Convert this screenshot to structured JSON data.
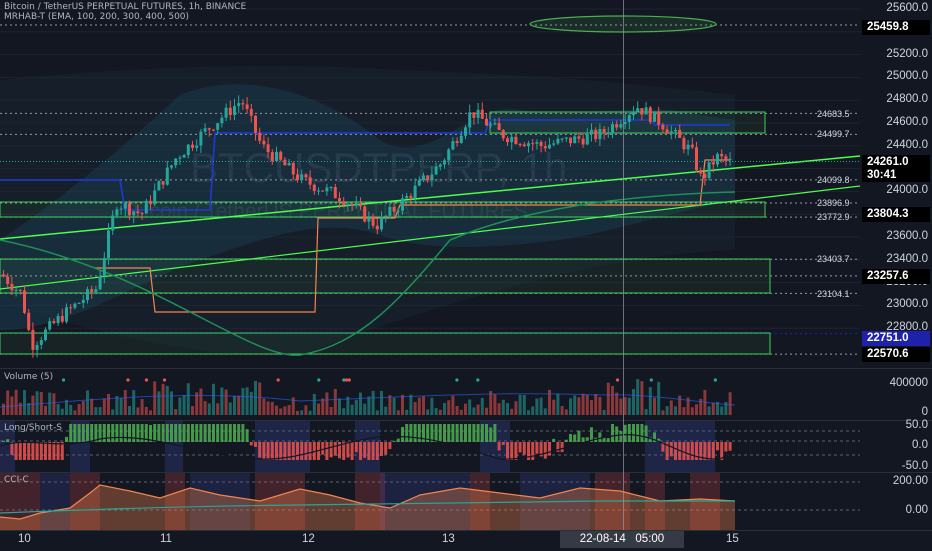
{
  "header": {
    "line1": "Bitcoin / TetherUS PERPETUAL FUTURES, 1h, BINANCE",
    "line2": "MRHAB-T (EMA, 100, 200, 300, 400, 500)"
  },
  "watermark": {
    "symbol": "BTCUSDTPERP, 1h",
    "name": "Bitcoin / TetherUS PERPETUAL FUTURES"
  },
  "price_axis": {
    "ticks": [
      "25600.0",
      "25400.0",
      "25200.0",
      "25000.0",
      "24800.0",
      "24600.0",
      "24400.0",
      "24200.0",
      "24000.0",
      "23800.0",
      "23600.0",
      "23400.0",
      "23200.0",
      "23000.0",
      "22800.0"
    ]
  },
  "price_boxes": {
    "top": "25459.8",
    "current": "24261.0",
    "countdown": "30:41",
    "level": "23804.3",
    "level2": "23257.6",
    "blue": "22751.0",
    "bottom": "22570.6"
  },
  "levels": {
    "l1": "24683.5",
    "l2": "24499.7",
    "l3": "24099.8",
    "l4": "23896.9",
    "l5": "23772.9",
    "l6": "23403.7",
    "l7": "23104.1"
  },
  "volume": {
    "title": "Volume (5)",
    "ticks": [
      "400000",
      "0"
    ]
  },
  "longshort": {
    "title": "Long/Short-S",
    "ticks": [
      "50.0",
      "0.0",
      "-50.0"
    ]
  },
  "cci": {
    "title": "CCI-C",
    "ticks": [
      "200.00",
      "0.00"
    ]
  },
  "time_axis": {
    "labels": [
      "10",
      "11",
      "12",
      "13",
      "15"
    ],
    "crosshair": "22-08-14   05:00"
  },
  "colors": {
    "bg": "#131722",
    "up": "#26a69a",
    "down": "#ef5350",
    "green_line": "#4cff4c",
    "blue_line": "#1e3ad6",
    "orange": "#f3844e"
  }
}
